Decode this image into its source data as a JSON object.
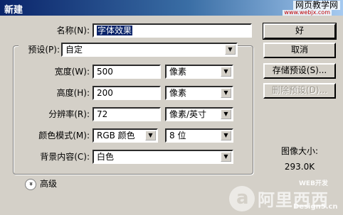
{
  "window": {
    "title": "新建"
  },
  "watermark_top": {
    "line1": "网页教学网",
    "line2": "www.webjx.com"
  },
  "name_field": {
    "label": "名称(N):",
    "value": "字体效果"
  },
  "preset": {
    "label": "预设(P):",
    "value": "自定"
  },
  "width": {
    "label": "宽度(W):",
    "value": "500",
    "unit": "像素"
  },
  "height": {
    "label": "高度(H):",
    "value": "200",
    "unit": "像素"
  },
  "resolution": {
    "label": "分辨率(R):",
    "value": "72",
    "unit": "像素/英寸"
  },
  "color_mode": {
    "label": "颜色模式(M):",
    "value": "RGB 颜色",
    "depth": "8 位"
  },
  "background": {
    "label": "背景内容(C):",
    "value": "白色"
  },
  "advanced": {
    "label": "高级"
  },
  "buttons": {
    "ok": "好",
    "cancel": "取消",
    "save_preset": "存储预设(S)...",
    "delete_preset": "删除预设(D)..."
  },
  "image_size": {
    "label": "图像大小:",
    "value": "293.0K"
  },
  "watermark_bottom": {
    "line1": "WEB开发",
    "brand": "阿里西西",
    "site": "Design5.cn"
  },
  "colors": {
    "accent": "#0a246a",
    "dialog_bg": "#d4d0c8"
  }
}
